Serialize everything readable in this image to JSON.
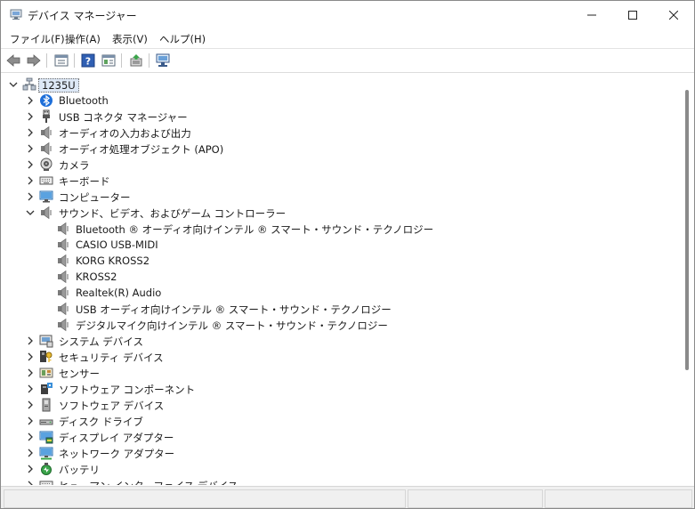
{
  "window": {
    "title": "デバイス マネージャー",
    "icon": "device-manager-icon",
    "controls": [
      "minimize-icon",
      "maximize-icon",
      "close-icon"
    ]
  },
  "menubar": {
    "file": "ファイル(F)",
    "action": "操作(A)",
    "view": "表示(V)",
    "help": "ヘルプ(H)"
  },
  "toolbar": {
    "buttons": [
      "back-icon",
      "forward-icon",
      "properties-pane-icon",
      "help-icon",
      "console-tree-icon",
      "update-driver-icon",
      "scan-hardware-icon"
    ]
  },
  "tree": {
    "root": {
      "label": "1235U",
      "icon": "computer-root-icon",
      "expanded": true
    },
    "items": [
      {
        "label": "Bluetooth",
        "icon": "bluetooth-icon",
        "level": 1,
        "expanded": false
      },
      {
        "label": "USB コネクタ マネージャー",
        "icon": "usb-connector-icon",
        "level": 1,
        "expanded": false
      },
      {
        "label": "オーディオの入力および出力",
        "icon": "speaker-icon",
        "level": 1,
        "expanded": false
      },
      {
        "label": "オーディオ処理オブジェクト (APO)",
        "icon": "speaker-icon",
        "level": 1,
        "expanded": false
      },
      {
        "label": "カメラ",
        "icon": "camera-icon",
        "level": 1,
        "expanded": false
      },
      {
        "label": "キーボード",
        "icon": "keyboard-icon",
        "level": 1,
        "expanded": false
      },
      {
        "label": "コンピューター",
        "icon": "monitor-icon",
        "level": 1,
        "expanded": false
      },
      {
        "label": "サウンド、ビデオ、およびゲーム コントローラー",
        "icon": "speaker-icon",
        "level": 1,
        "expanded": true
      },
      {
        "label": "Bluetooth ® オーディオ向けインテル ® スマート・サウンド・テクノロジー",
        "icon": "speaker-icon",
        "level": 2
      },
      {
        "label": "CASIO USB-MIDI",
        "icon": "speaker-icon",
        "level": 2
      },
      {
        "label": "KORG KROSS2",
        "icon": "speaker-icon",
        "level": 2
      },
      {
        "label": "KROSS2",
        "icon": "speaker-icon",
        "level": 2
      },
      {
        "label": "Realtek(R) Audio",
        "icon": "speaker-icon",
        "level": 2
      },
      {
        "label": "USB オーディオ向けインテル ® スマート・サウンド・テクノロジー",
        "icon": "speaker-icon",
        "level": 2
      },
      {
        "label": "デジタルマイク向けインテル ® スマート・サウンド・テクノロジー",
        "icon": "speaker-icon",
        "level": 2
      },
      {
        "label": "システム デバイス",
        "icon": "system-device-icon",
        "level": 1,
        "expanded": false
      },
      {
        "label": "セキュリティ デバイス",
        "icon": "security-key-icon",
        "level": 1,
        "expanded": false
      },
      {
        "label": "センサー",
        "icon": "sensor-icon",
        "level": 1,
        "expanded": false
      },
      {
        "label": "ソフトウェア コンポーネント",
        "icon": "software-component-icon",
        "level": 1,
        "expanded": false
      },
      {
        "label": "ソフトウェア デバイス",
        "icon": "software-device-icon",
        "level": 1,
        "expanded": false
      },
      {
        "label": "ディスク ドライブ",
        "icon": "disk-drive-icon",
        "level": 1,
        "expanded": false
      },
      {
        "label": "ディスプレイ アダプター",
        "icon": "display-adapter-icon",
        "level": 1,
        "expanded": false
      },
      {
        "label": "ネットワーク アダプター",
        "icon": "network-adapter-icon",
        "level": 1,
        "expanded": false
      },
      {
        "label": "バッテリ",
        "icon": "battery-icon",
        "level": 1,
        "expanded": false
      },
      {
        "label": "ヒューマン インターフェイス デバイス",
        "icon": "hid-icon",
        "level": 1,
        "expanded": false
      }
    ]
  },
  "colors": {
    "selection": "#dde8f6",
    "bluetooth": "#1e6fd9",
    "scrollbar_thumb": "#8a8a8a"
  }
}
